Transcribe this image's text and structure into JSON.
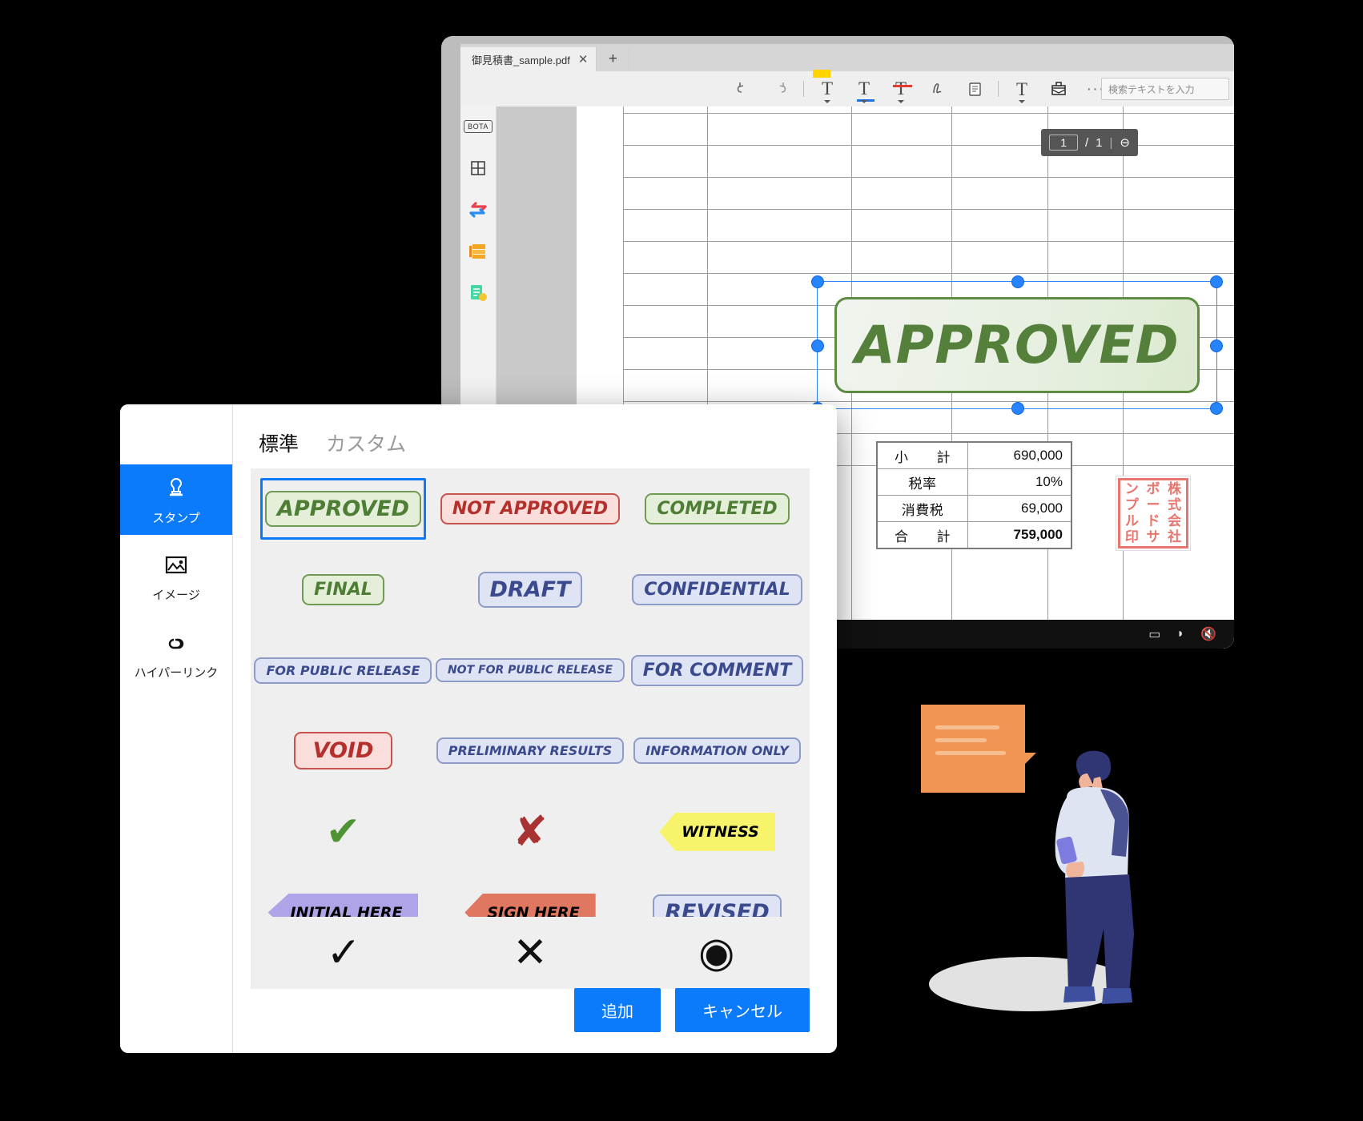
{
  "viewer": {
    "tab": {
      "title": "御見積書_sample.pdf",
      "close_label": "✕",
      "new_tab_label": "+"
    },
    "toolbar": {
      "undo": "undo-icon",
      "redo": "redo-icon",
      "highlight": "T",
      "underline": "T",
      "strikethrough": "T",
      "freehand": "pen-icon",
      "note": "sticky-note-icon",
      "text": "T",
      "stamp": "stamp-toolbox-icon",
      "more": "···"
    },
    "search": {
      "placeholder": "検索テキストを入力"
    },
    "left_rail": [
      {
        "name": "bota",
        "label": "BOTA"
      },
      {
        "name": "grid",
        "label": "⊞"
      },
      {
        "name": "swap-arrows",
        "label": "⇄"
      },
      {
        "name": "stack",
        "label": "≡"
      },
      {
        "name": "checklist",
        "label": "✓"
      }
    ],
    "pager": {
      "current": "1",
      "separator": "/",
      "total": "1"
    },
    "document_stamp": {
      "label": "APPROVED"
    },
    "totals": [
      {
        "label": "小　　計",
        "value": "690,000",
        "bold": false
      },
      {
        "label": "税率",
        "value": "10%",
        "bold": false
      },
      {
        "label": "消費税",
        "value": "69,000",
        "bold": false
      },
      {
        "label": "合　　計",
        "value": "759,000",
        "bold": true
      }
    ],
    "hanko": [
      "ン",
      "ボ",
      "株",
      "プ",
      "ー",
      "式",
      "ル",
      "ド",
      "会",
      "印",
      "サ",
      "社"
    ]
  },
  "dialog": {
    "nav": [
      {
        "label": "スタンプ",
        "icon": "stamp-icon",
        "active": true
      },
      {
        "label": "イメージ",
        "icon": "image-icon",
        "active": false
      },
      {
        "label": "ハイパーリンク",
        "icon": "link-icon",
        "active": false
      }
    ],
    "tabs": [
      {
        "label": "標準",
        "active": true
      },
      {
        "label": "カスタム",
        "active": false
      }
    ],
    "stamps": [
      {
        "label": "APPROVED",
        "style": "green",
        "size": "lg",
        "shape": "chip",
        "selected": true
      },
      {
        "label": "NOT APPROVED",
        "style": "red",
        "size": "md",
        "shape": "chip",
        "selected": false
      },
      {
        "label": "COMPLETED",
        "style": "green",
        "size": "md",
        "shape": "chip",
        "selected": false
      },
      {
        "label": "FINAL",
        "style": "green",
        "size": "md",
        "shape": "chip",
        "selected": false
      },
      {
        "label": "DRAFT",
        "style": "blue",
        "size": "lg",
        "shape": "chip",
        "selected": false
      },
      {
        "label": "CONFIDENTIAL",
        "style": "blue",
        "size": "md",
        "shape": "chip",
        "selected": false
      },
      {
        "label": "FOR PUBLIC RELEASE",
        "style": "blue",
        "size": "sm",
        "shape": "chip",
        "selected": false
      },
      {
        "label": "NOT FOR PUBLIC RELEASE",
        "style": "blue",
        "size": "xs",
        "shape": "chip",
        "selected": false
      },
      {
        "label": "FOR COMMENT",
        "style": "blue",
        "size": "md",
        "shape": "chip",
        "selected": false
      },
      {
        "label": "VOID",
        "style": "red",
        "size": "lg",
        "shape": "chip",
        "selected": false
      },
      {
        "label": "PRELIMINARY RESULTS",
        "style": "blue",
        "size": "sm",
        "shape": "chip",
        "selected": false
      },
      {
        "label": "INFORMATION ONLY",
        "style": "blue",
        "size": "sm",
        "shape": "chip",
        "selected": false
      },
      {
        "label": "✔",
        "style": "glyph-green",
        "size": "lg",
        "shape": "glyph",
        "selected": false
      },
      {
        "label": "✘",
        "style": "glyph-red",
        "size": "lg",
        "shape": "glyph",
        "selected": false
      },
      {
        "label": "WITNESS",
        "style": "yellow",
        "size": "md",
        "shape": "arrow-left",
        "selected": false
      },
      {
        "label": "INITIAL HERE",
        "style": "purple",
        "size": "md",
        "shape": "arrow-left",
        "selected": false
      },
      {
        "label": "SIGN HERE",
        "style": "salmon",
        "size": "md",
        "shape": "arrow-left",
        "selected": false
      },
      {
        "label": "REVISED",
        "style": "blue",
        "size": "lg",
        "shape": "chip",
        "selected": false
      },
      {
        "label": "✓",
        "style": "plain",
        "size": "lg",
        "shape": "glyph",
        "selected": false
      },
      {
        "label": "✕",
        "style": "plain",
        "size": "lg",
        "shape": "glyph",
        "selected": false
      },
      {
        "label": "◉",
        "style": "plain",
        "size": "lg",
        "shape": "glyph",
        "selected": false
      }
    ],
    "buttons": {
      "add": "追加",
      "cancel": "キャンセル"
    }
  },
  "colors": {
    "accent": "#0b7bfb",
    "green": "#4e7d35",
    "red": "#b4302c",
    "blue": "#3b4a8c",
    "yellow": "#f7f36b",
    "purple": "#b0a4e8",
    "salmon": "#e07760",
    "hanko_red": "#e8756e"
  }
}
